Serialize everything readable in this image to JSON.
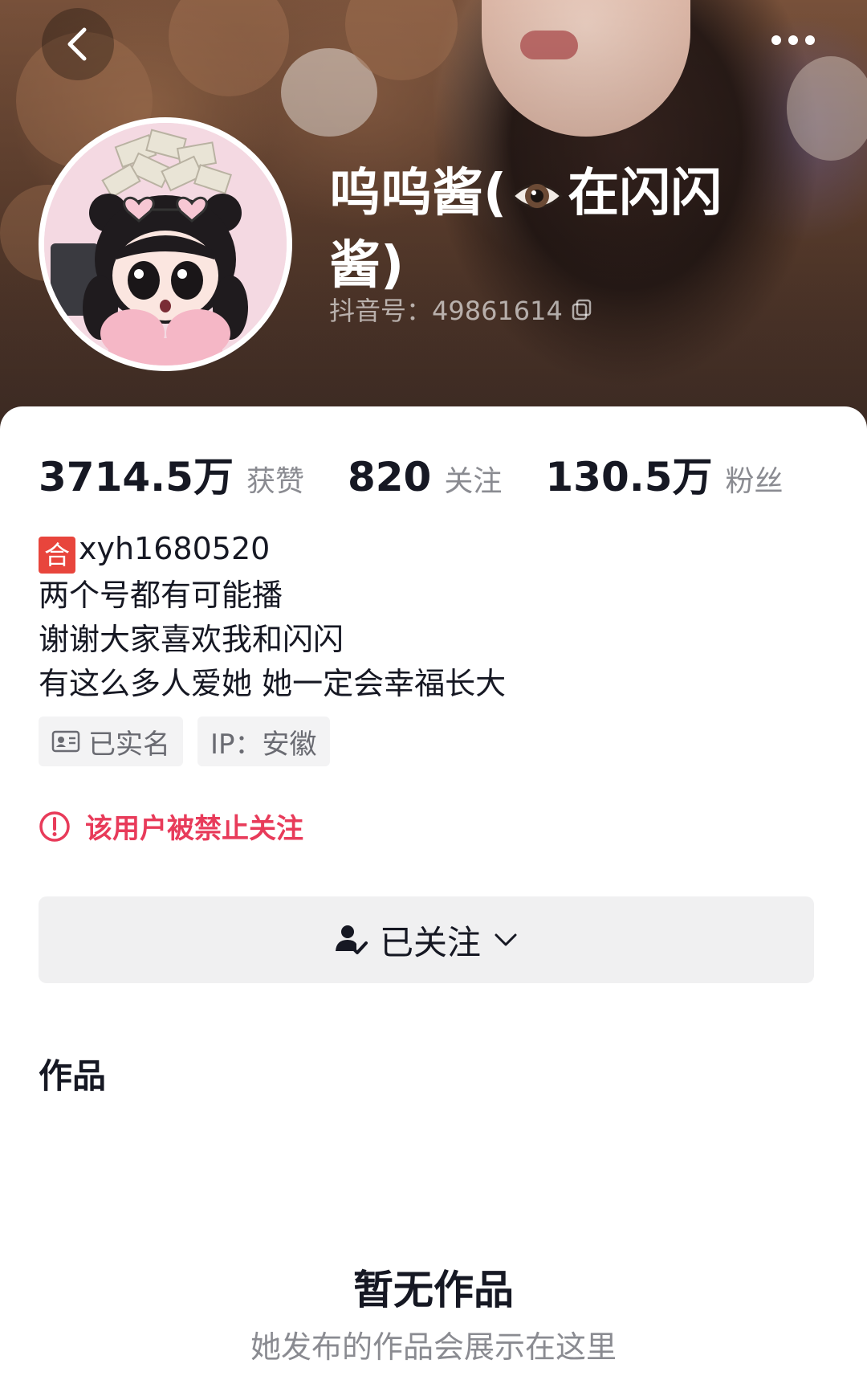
{
  "profile": {
    "name_part1": "呜呜酱(",
    "name_part2": "在闪闪",
    "name_line2": "酱)",
    "douyin_id": "抖音号：49861614"
  },
  "stats": [
    {
      "value": "3714.5万",
      "label": "获赞"
    },
    {
      "value": "820",
      "label": "关注"
    },
    {
      "value": "130.5万",
      "label": "粉丝"
    }
  ],
  "bio": {
    "collab_tag": "合",
    "collab_account": "xyh1680520",
    "lines": [
      "两个号都有可能播",
      "谢谢大家喜欢我和闪闪",
      "有这么多人爱她 她一定会幸福长大"
    ]
  },
  "chips": {
    "verified": "已实名",
    "ip": "IP：安徽"
  },
  "notice": {
    "ban_text": "该用户被禁止关注"
  },
  "follow_button": {
    "label": "已关注"
  },
  "tabs": {
    "works": "作品"
  },
  "empty_state": {
    "title": "暂无作品",
    "subtitle": "她发布的作品会展示在这里"
  },
  "icons": {
    "back": "back-arrow-icon",
    "more": "more-dots-icon",
    "eye": "eye-emoji-icon",
    "copy": "copy-icon",
    "id_card": "id-card-icon",
    "warning": "warning-circle-icon",
    "followed_user": "user-check-icon",
    "chevron": "chevron-down-icon"
  },
  "colors": {
    "accent_red": "#e83b5a",
    "collab_tag_red": "#e8453c",
    "muted_text": "#8a8b91"
  }
}
